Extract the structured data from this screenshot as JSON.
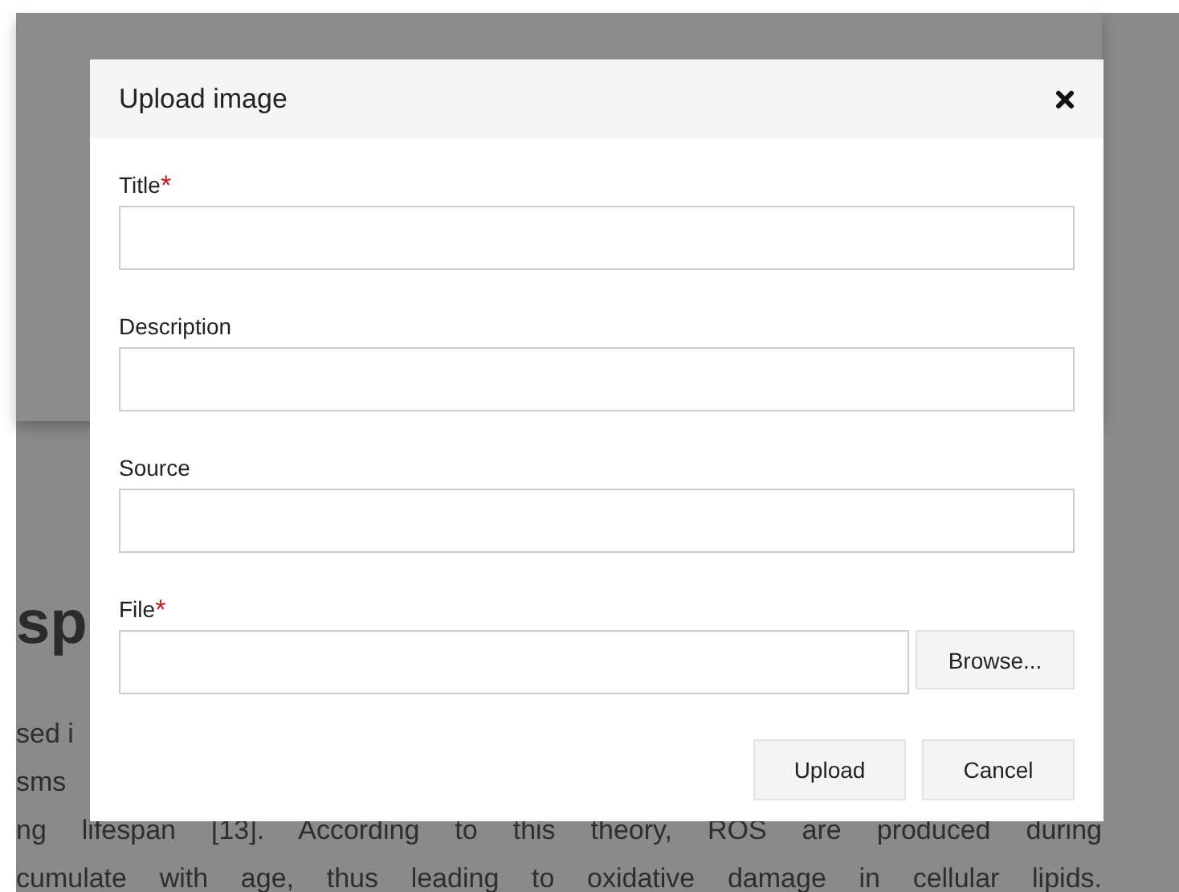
{
  "background": {
    "heading": "sp",
    "lines": [
      "sed i",
      "sms",
      "ng lifespan [13]. According to this theory, ROS are produced during",
      "cumulate with age, thus leading to oxidative damage in cellular lipids."
    ]
  },
  "dialog": {
    "title": "Upload image",
    "required_mark": "*",
    "fields": [
      {
        "label": "Title",
        "required": true,
        "kind": "text"
      },
      {
        "label": "Description",
        "required": false,
        "kind": "text"
      },
      {
        "label": "Source",
        "required": false,
        "kind": "text"
      },
      {
        "label": "File",
        "required": true,
        "kind": "file",
        "button": "Browse..."
      }
    ],
    "buttons": [
      "Upload",
      "Cancel"
    ]
  }
}
